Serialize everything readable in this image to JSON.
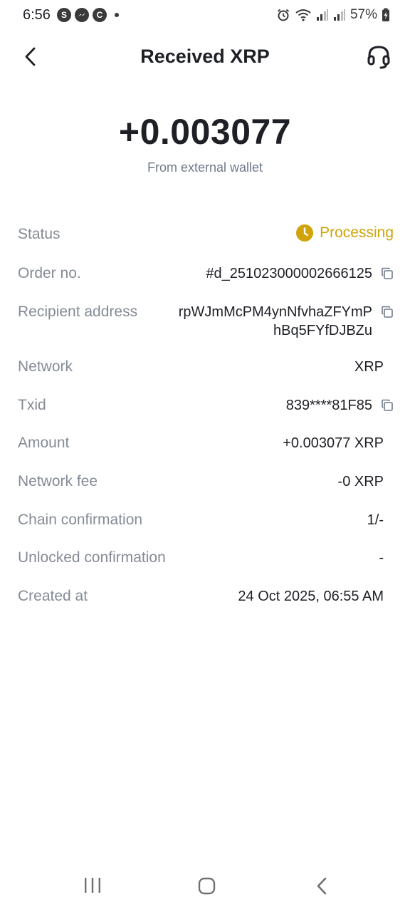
{
  "status_bar": {
    "time": "6:56",
    "battery": "57%",
    "app_icons": [
      "S",
      "messenger-icon",
      "C"
    ]
  },
  "header": {
    "title": "Received XRP"
  },
  "summary": {
    "amount": "+0.003077",
    "source": "From external wallet"
  },
  "details": {
    "status": {
      "label": "Status",
      "value": "Processing"
    },
    "order_no": {
      "label": "Order no.",
      "value": "#d_251023000002666125"
    },
    "recipient_address": {
      "label": "Recipient address",
      "line1": "rpWJmMcPM4ynNfvhaZFYmP",
      "line2": "hBq5FYfDJBZu"
    },
    "network": {
      "label": "Network",
      "value": "XRP"
    },
    "txid": {
      "label": "Txid",
      "value": "839****81F85"
    },
    "amount": {
      "label": "Amount",
      "value": "+0.003077 XRP"
    },
    "network_fee": {
      "label": "Network fee",
      "value": "-0 XRP"
    },
    "chain_confirmation": {
      "label": "Chain confirmation",
      "value": "1/-"
    },
    "unlocked_confirmation": {
      "label": "Unlocked confirmation",
      "value": "-"
    },
    "created_at": {
      "label": "Created at",
      "value": "24 Oct 2025, 06:55 AM"
    }
  },
  "colors": {
    "status_processing": "#d0a40a",
    "label_gray": "#858b96",
    "text_dark": "#1e2026"
  }
}
